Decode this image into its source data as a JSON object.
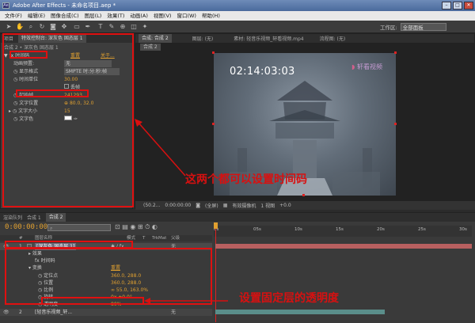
{
  "window": {
    "title": "Adobe After Effects - 未命名项目.aep *"
  },
  "menu": [
    "文件(F)",
    "编辑(E)",
    "图像合成(C)",
    "图层(L)",
    "效果(T)",
    "动画(A)",
    "视图(V)",
    "窗口(W)",
    "帮助(H)"
  ],
  "toolbar": {
    "workspace_label": "工作区:",
    "workspace_value": "全部面板"
  },
  "left_panel": {
    "tabs": [
      "项目",
      "特效控制台: 深灰色 固态层 1"
    ],
    "breadcrumb": "合成 2 • 深灰色 固态层 1",
    "effect_name": "时间码",
    "reset": "重置",
    "about": "关于...",
    "props": [
      {
        "label": "动画预置:",
        "value": "无"
      },
      {
        "label": "显示格式",
        "value": "SMPTE 时:分:秒:帧"
      },
      {
        "label": "时间单位",
        "value": "30.00"
      },
      {
        "label": "",
        "value": "丢帧"
      },
      {
        "label": "起始帧",
        "value": "241293"
      },
      {
        "label": "文字位置",
        "value": "80.0, 32.0"
      },
      {
        "label": "文字大小",
        "value": "15"
      },
      {
        "label": "文字色",
        "value": ""
      }
    ]
  },
  "viewer": {
    "tabs": [
      "合成: 合成 2",
      "图层: (无)",
      "素材: 轻音乐视频_轩看视频.mp4",
      "流程图: (无)"
    ],
    "comp_tab": "合成 2",
    "video_timecode": "02:14:03:03",
    "logo_text": "轩看视频",
    "bottom": [
      "(50.2...",
      "0:00:00:00",
      "(全屏)",
      "有效摄像机",
      "1 视图",
      "+0.0"
    ]
  },
  "timeline": {
    "tabs": [
      "渲染队列",
      "合成 1",
      "合成 2"
    ],
    "current_time": "0:00:00:00",
    "columns": [
      "#",
      "图层名称",
      "模式",
      "T",
      "TrkMat",
      "父级"
    ],
    "ruler": [
      "0s",
      "05s",
      "10s",
      "15s",
      "20s",
      "25s",
      "30s"
    ],
    "rows": [
      {
        "num": "1",
        "name": "[深灰色 固态层 1]",
        "parent": "无"
      },
      {
        "name": "效果"
      },
      {
        "name": "时间码",
        "extra": ""
      },
      {
        "name": "变换",
        "extra": "重置"
      },
      {
        "name": "定位点",
        "value": "360.0, 288.0"
      },
      {
        "name": "位置",
        "value": "360.0, 288.0"
      },
      {
        "name": "比例",
        "value": "55.0, 163.0%"
      },
      {
        "name": "旋转",
        "value": "0x +0.0°"
      },
      {
        "name": "透明度",
        "value": "80%"
      },
      {
        "num": "2",
        "name": "[轻音乐视频_轩...",
        "parent": "无"
      }
    ]
  },
  "annotations": {
    "upper": "这两个都可以设置时间码",
    "lower": "设置固定层的透明度"
  },
  "colors": {
    "annotation": "#d81010",
    "accent": "#e0a030"
  }
}
